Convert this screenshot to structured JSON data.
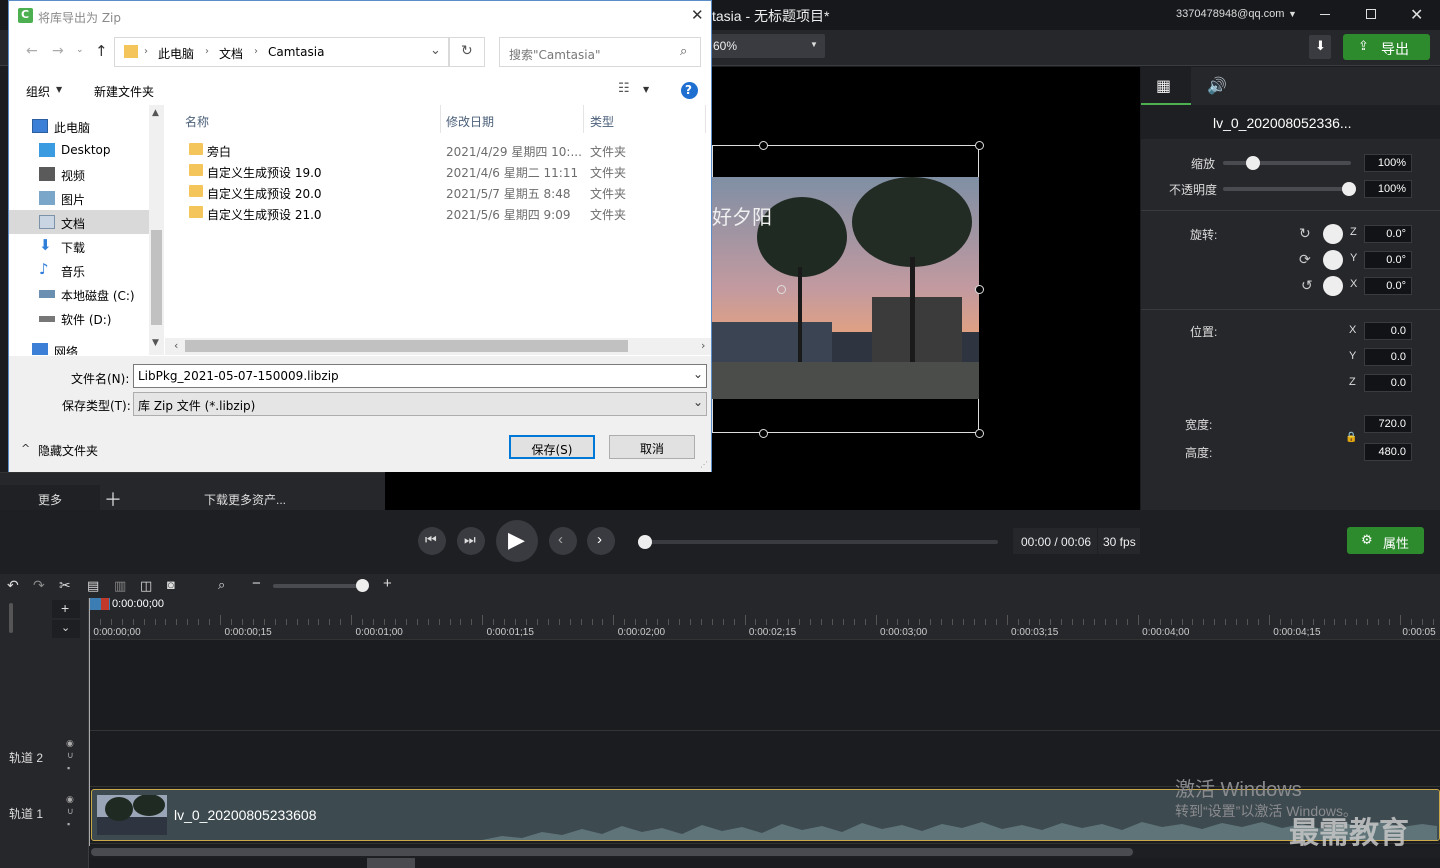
{
  "app": {
    "title": "tasia - 无标题项目*",
    "account": "3370478948@qq.com",
    "zoom": "60%",
    "export_label": "导出",
    "more_label": "更多",
    "download_more_label": "下载更多资产..."
  },
  "properties": {
    "clip_name": "lv_0_202008052336...",
    "scale_label": "缩放",
    "scale_value": "100%",
    "opacity_label": "不透明度",
    "opacity_value": "100%",
    "rotation_label": "旋转:",
    "rot_z": "0.0°",
    "rot_y": "0.0°",
    "rot_x": "0.0°",
    "position_label": "位置:",
    "pos_x": "0.0",
    "pos_y": "0.0",
    "pos_z": "0.0",
    "width_label": "宽度:",
    "width_value": "720.0",
    "height_label": "高度:",
    "height_value": "480.0",
    "axis_x": "X",
    "axis_y": "Y",
    "axis_z": "Z"
  },
  "preview": {
    "overlay_text": "好夕阳"
  },
  "transport": {
    "time": "00:00 / 00:06",
    "fps": "30 fps",
    "properties_label": "属性",
    "progress": 0
  },
  "timeline": {
    "playhead_time": "0:00:00;00",
    "ruler_labels": [
      "0:00:00;00",
      "0:00:00;15",
      "0:00:01;00",
      "0:00:01;15",
      "0:00:02;00",
      "0:00:02;15",
      "0:00:03;00",
      "0:00:03;15",
      "0:00:04;00",
      "0:00:04;15",
      "0:00:05"
    ],
    "track2_label": "轨道 2",
    "track1_label": "轨道 1",
    "clip_label": "lv_0_20200805233608"
  },
  "watermark": {
    "line1": "激活 Windows",
    "line2": "转到“设置”以激活 Windows。",
    "brand": "最需教育"
  },
  "dialog": {
    "title": "将库导出为 Zip",
    "breadcrumb": [
      "此电脑",
      "文档",
      "Camtasia"
    ],
    "search_placeholder": "搜索\"Camtasia\"",
    "organize_label": "组织",
    "new_folder_label": "新建文件夹",
    "nav_items": [
      "此电脑",
      "Desktop",
      "视频",
      "图片",
      "文档",
      "下载",
      "音乐",
      "本地磁盘 (C:)",
      "软件 (D:)",
      "网络"
    ],
    "columns": [
      "名称",
      "修改日期",
      "类型"
    ],
    "files": [
      {
        "name": "旁白",
        "date": "2021/4/29 星期四 10:...",
        "type": "文件夹"
      },
      {
        "name": "自定义生成预设 19.0",
        "date": "2021/4/6 星期二 11:11",
        "type": "文件夹"
      },
      {
        "name": "自定义生成预设 20.0",
        "date": "2021/5/7 星期五 8:48",
        "type": "文件夹"
      },
      {
        "name": "自定义生成预设 21.0",
        "date": "2021/5/6 星期四 9:09",
        "type": "文件夹"
      }
    ],
    "filename_label": "文件名(N):",
    "filename_value": "LibPkg_2021-05-07-150009.libzip",
    "filetype_label": "保存类型(T):",
    "filetype_value": "库 Zip 文件 (*.libzip)",
    "hide_folders_label": "隐藏文件夹",
    "save_label": "保存(S)",
    "cancel_label": "取消"
  }
}
